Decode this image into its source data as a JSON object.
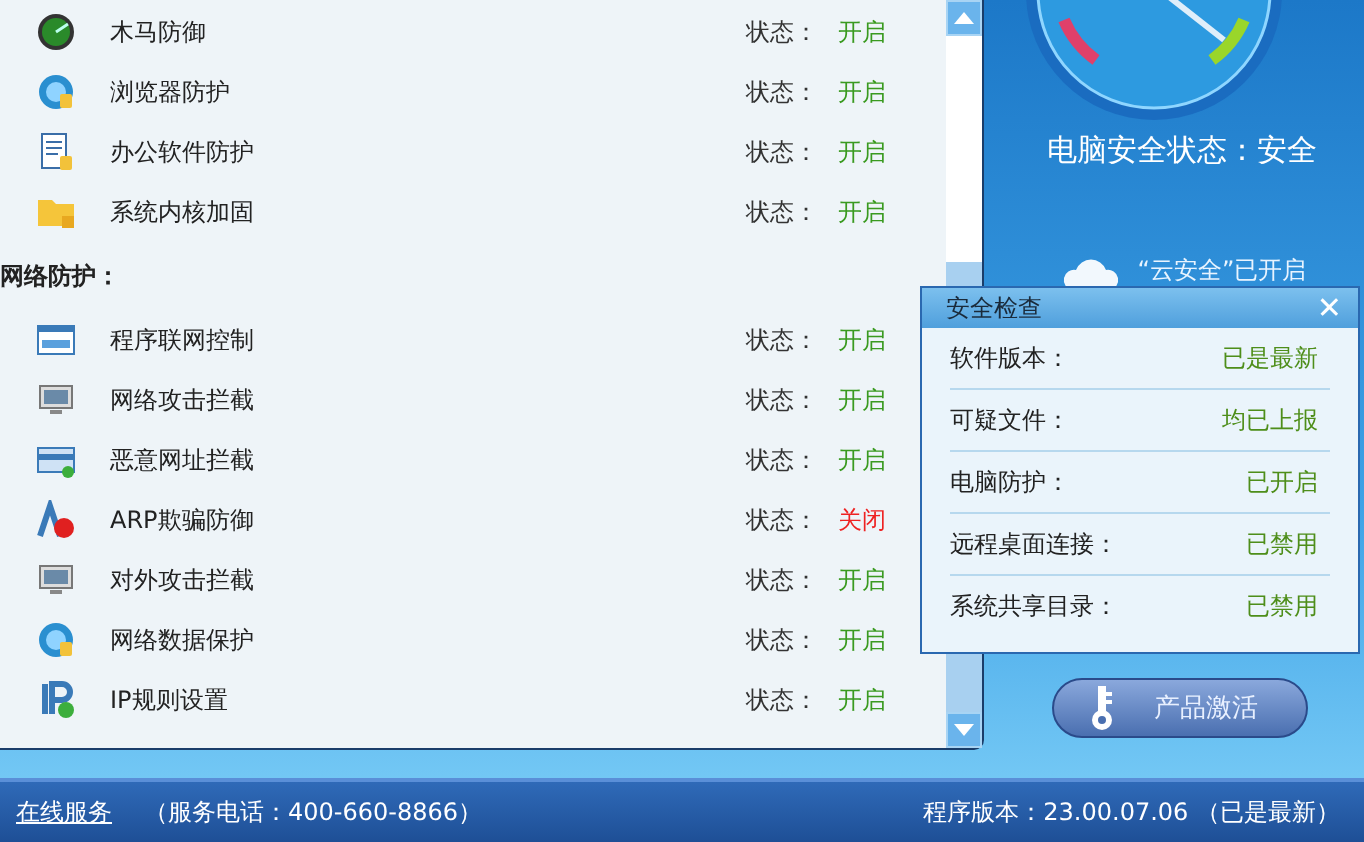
{
  "groups": [
    {
      "items": [
        {
          "kind": "radar",
          "name": "木马防御",
          "status_label": "状态：",
          "status": "开启",
          "on": true
        },
        {
          "kind": "globe",
          "name": "浏览器防护",
          "status_label": "状态：",
          "status": "开启",
          "on": true
        },
        {
          "kind": "document",
          "name": "办公软件防护",
          "status_label": "状态：",
          "status": "开启",
          "on": true
        },
        {
          "kind": "folder",
          "name": "系统内核加固",
          "status_label": "状态：",
          "status": "开启",
          "on": true
        }
      ]
    },
    {
      "heading": "网络防护：",
      "items": [
        {
          "kind": "window",
          "name": "程序联网控制",
          "status_label": "状态：",
          "status": "开启",
          "on": true
        },
        {
          "kind": "monitor",
          "name": "网络攻击拦截",
          "status_label": "状态：",
          "status": "开启",
          "on": true
        },
        {
          "kind": "card",
          "name": "恶意网址拦截",
          "status_label": "状态：",
          "status": "开启",
          "on": true
        },
        {
          "kind": "arp",
          "name": "ARP欺骗防御",
          "status_label": "状态：",
          "status": "关闭",
          "on": false
        },
        {
          "kind": "monitor",
          "name": "对外攻击拦截",
          "status_label": "状态：",
          "status": "开启",
          "on": true
        },
        {
          "kind": "globe",
          "name": "网络数据保护",
          "status_label": "状态：",
          "status": "开启",
          "on": true
        },
        {
          "kind": "ip",
          "name": "IP规则设置",
          "status_label": "状态：",
          "status": "开启",
          "on": true
        }
      ]
    }
  ],
  "security_status": "电脑安全状态：安全",
  "cloud_status": "“云安全”已开启",
  "check_popup": {
    "title": "安全检查",
    "close": "✕",
    "rows": [
      {
        "label": "软件版本：",
        "value": "已是最新"
      },
      {
        "label": "可疑文件：",
        "value": "均已上报"
      },
      {
        "label": "电脑防护：",
        "value": "已开启"
      },
      {
        "label": "远程桌面连接：",
        "value": "已禁用"
      },
      {
        "label": "系统共享目录：",
        "value": "已禁用"
      }
    ]
  },
  "activate_button": "产品激活",
  "footer": {
    "online_service": "在线服务",
    "hotline": "（服务电话：400-660-8866）",
    "version": "程序版本：23.00.07.06 （已是最新）"
  }
}
